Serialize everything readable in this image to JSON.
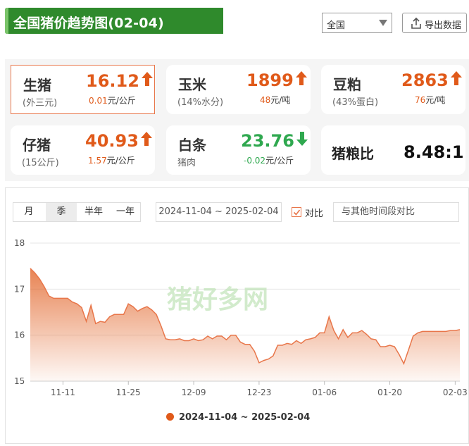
{
  "header": {
    "title": "全国猪价趋势图(02-04)",
    "region": "全国",
    "export_label": "导出数据"
  },
  "cards": [
    {
      "name": "生猪",
      "sub": "(外三元)",
      "price": "16.12",
      "direction": "up",
      "change": "0.01",
      "unit": "元/公斤",
      "active": true
    },
    {
      "name": "玉米",
      "sub": "(14%水分)",
      "price": "1899",
      "direction": "up",
      "change": "48",
      "unit": "元/吨"
    },
    {
      "name": "豆粕",
      "sub": "(43%蛋白)",
      "price": "2863",
      "direction": "up",
      "change": "76",
      "unit": "元/吨"
    },
    {
      "name": "仔猪",
      "sub": "(15公斤)",
      "price": "40.93",
      "direction": "up",
      "change": "1.57",
      "unit": "元/公斤"
    },
    {
      "name": "白条",
      "sub": "猪肉",
      "price": "23.76",
      "direction": "down",
      "change": "-0.02",
      "unit": "元/公斤"
    }
  ],
  "ratio": {
    "label": "猪粮比",
    "value": "8.48:1"
  },
  "controls": {
    "tabs": [
      "月",
      "季",
      "半年",
      "一年"
    ],
    "selected_tab": "季",
    "date_range": "2024-11-04 ~ 2025-02-04",
    "compare_label": "对比",
    "compare_checked": true,
    "compare_placeholder": "与其他时间段对比"
  },
  "colors": {
    "accent": "#e05a1a",
    "up": "#e05a1a",
    "down": "#2fa84f",
    "title_bg": "#2f8a2c"
  },
  "chart_data": {
    "type": "area",
    "x_start": "2024-11-04",
    "x_end": "2025-02-04",
    "x_ticks": [
      "11-11",
      "11-25",
      "12-09",
      "12-23",
      "01-06",
      "01-20",
      "02-03"
    ],
    "ylim": [
      15,
      18
    ],
    "y_ticks": [
      15,
      16,
      17,
      18
    ],
    "grid": true,
    "legend_position": "bottom",
    "watermark": "猪好多网",
    "series": [
      {
        "name": "2024-11-04 ~ 2025-02-04",
        "color": "#e05a1a",
        "x": [
          "2024-11-04",
          "2024-11-05",
          "2024-11-06",
          "2024-11-07",
          "2024-11-08",
          "2024-11-09",
          "2024-11-10",
          "2024-11-11",
          "2024-11-12",
          "2024-11-13",
          "2024-11-14",
          "2024-11-15",
          "2024-11-16",
          "2024-11-17",
          "2024-11-18",
          "2024-11-19",
          "2024-11-20",
          "2024-11-21",
          "2024-11-22",
          "2024-11-23",
          "2024-11-24",
          "2024-11-25",
          "2024-11-26",
          "2024-11-27",
          "2024-11-28",
          "2024-11-29",
          "2024-11-30",
          "2024-12-01",
          "2024-12-02",
          "2024-12-03",
          "2024-12-04",
          "2024-12-05",
          "2024-12-06",
          "2024-12-07",
          "2024-12-08",
          "2024-12-09",
          "2024-12-10",
          "2024-12-11",
          "2024-12-12",
          "2024-12-13",
          "2024-12-14",
          "2024-12-15",
          "2024-12-16",
          "2024-12-17",
          "2024-12-18",
          "2024-12-19",
          "2024-12-20",
          "2024-12-21",
          "2024-12-22",
          "2024-12-23",
          "2024-12-24",
          "2024-12-25",
          "2024-12-26",
          "2024-12-27",
          "2024-12-28",
          "2024-12-29",
          "2024-12-30",
          "2024-12-31",
          "2025-01-01",
          "2025-01-02",
          "2025-01-03",
          "2025-01-04",
          "2025-01-05",
          "2025-01-06",
          "2025-01-07",
          "2025-01-08",
          "2025-01-09",
          "2025-01-10",
          "2025-01-11",
          "2025-01-12",
          "2025-01-13",
          "2025-01-14",
          "2025-01-15",
          "2025-01-16",
          "2025-01-17",
          "2025-01-18",
          "2025-01-19",
          "2025-01-20",
          "2025-01-21",
          "2025-01-22",
          "2025-01-23",
          "2025-01-24",
          "2025-01-25",
          "2025-01-26",
          "2025-01-27",
          "2025-01-28",
          "2025-01-29",
          "2025-01-30",
          "2025-01-31",
          "2025-02-01",
          "2025-02-02",
          "2025-02-03",
          "2025-02-04"
        ],
        "values": [
          17.45,
          17.35,
          17.22,
          17.05,
          16.85,
          16.8,
          16.8,
          16.8,
          16.8,
          16.72,
          16.68,
          16.6,
          16.3,
          16.65,
          16.25,
          16.3,
          16.28,
          16.4,
          16.45,
          16.45,
          16.45,
          16.68,
          16.62,
          16.52,
          16.58,
          16.62,
          16.55,
          16.45,
          16.2,
          15.92,
          15.9,
          15.9,
          15.92,
          15.88,
          15.88,
          15.92,
          15.88,
          15.9,
          15.98,
          15.92,
          15.98,
          15.98,
          15.9,
          16.0,
          16.0,
          15.85,
          15.8,
          15.8,
          15.65,
          15.4,
          15.45,
          15.48,
          15.55,
          15.78,
          15.78,
          15.82,
          15.8,
          15.88,
          15.82,
          15.9,
          15.92,
          15.95,
          16.05,
          16.05,
          16.4,
          16.1,
          15.92,
          16.12,
          15.95,
          16.05,
          16.05,
          16.1,
          16.02,
          15.92,
          15.9,
          15.75,
          15.75,
          15.78,
          15.75,
          15.58,
          15.38,
          15.68,
          15.98,
          16.05,
          16.08,
          16.08,
          16.08,
          16.08,
          16.08,
          16.08,
          16.1,
          16.1,
          16.12
        ]
      }
    ]
  }
}
